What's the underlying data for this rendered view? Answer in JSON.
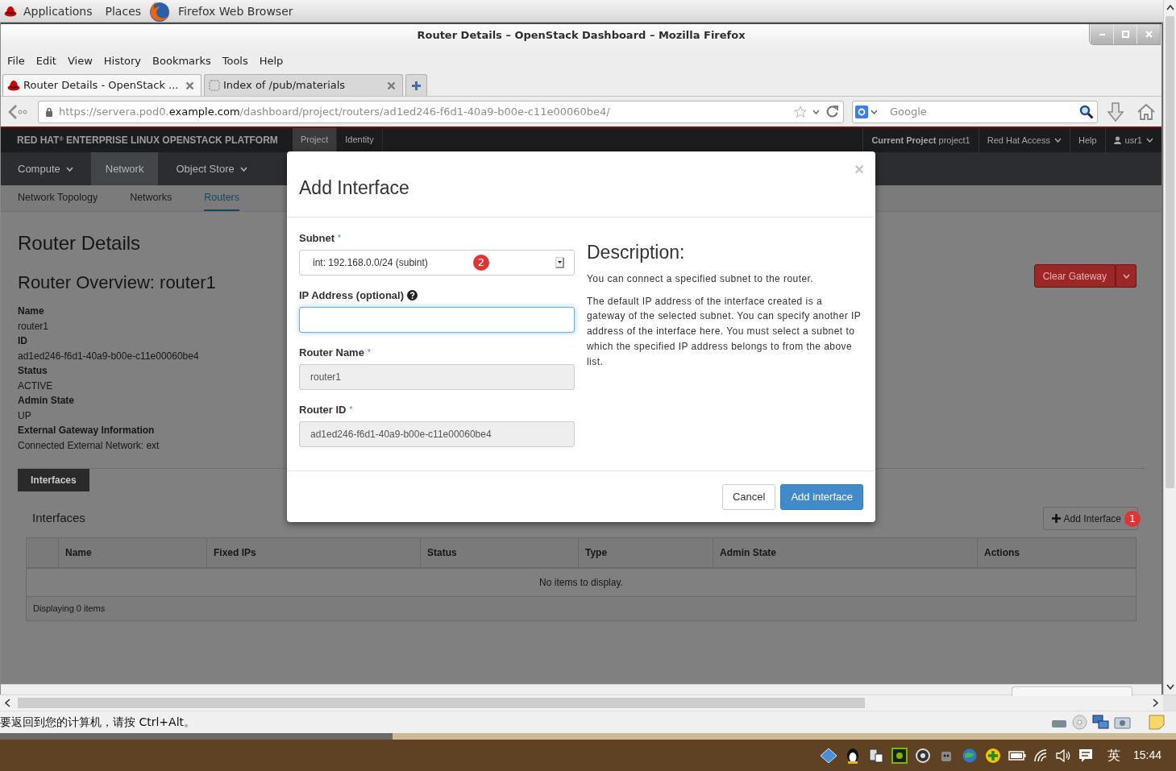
{
  "desktop": {
    "menus": [
      "Applications",
      "Places"
    ],
    "app_name": "Firefox Web Browser"
  },
  "browser": {
    "title": "Router Details – OpenStack Dashboard – Mozilla Firefox",
    "menu": [
      "File",
      "Edit",
      "View",
      "History",
      "Bookmarks",
      "Tools",
      "Help"
    ],
    "tabs": [
      {
        "label": "Router Details - OpenStack ...",
        "selected": true,
        "kind": "site"
      },
      {
        "label": "Index of /pub/materials",
        "selected": false,
        "kind": "blank"
      }
    ],
    "url": [
      {
        "text": "https://servera.pod0.",
        "highlight": false
      },
      {
        "text": "example.com",
        "highlight": true
      },
      {
        "text": "/dashboard/project/routers/ad1ed246-f6d1-40a9-b00e-c11e00060be4/",
        "highlight": false
      }
    ],
    "search": {
      "placeholder": "Google"
    }
  },
  "dashboard": {
    "brand": "RED HAT$^{®}$ ENTERPRISE LINUX OPENSTACK PLATFORM",
    "sections": [
      {
        "label": "Project",
        "selected": true
      },
      {
        "label": "Identity",
        "selected": false
      }
    ],
    "account": [
      {
        "label": "**Current Project** project1",
        "kind": "project"
      },
      {
        "label": "Red Hat Access",
        "kind": "menu"
      },
      {
        "label": "Help",
        "kind": "link"
      },
      {
        "label": "usr1",
        "kind": "user"
      }
    ],
    "panels": [
      {
        "label": "Compute",
        "selected": false,
        "dropdown": true
      },
      {
        "label": "Network",
        "selected": true,
        "dropdown": false
      },
      {
        "label": "Object Store",
        "selected": false,
        "dropdown": true
      }
    ],
    "subnav": [
      {
        "label": "Network Topology",
        "selected": false
      },
      {
        "label": "Networks",
        "selected": false
      },
      {
        "label": "Routers",
        "selected": true
      }
    ],
    "page_title": "Router Details",
    "overview_title": "Router Overview: router1",
    "details": [
      {
        "term": "Name",
        "value": "router1"
      },
      {
        "term": "ID",
        "value": "ad1ed246-f6d1-40a9-b00e-c11e00060be4"
      },
      {
        "term": "Status",
        "value": "ACTIVE"
      },
      {
        "term": "Admin State",
        "value": "UP"
      },
      {
        "term": "External Gateway Information",
        "value": "Connected External Network: ext"
      }
    ],
    "clear_gateway_button": "Clear Gateway",
    "detail_tabs": [
      {
        "label": "Interfaces",
        "selected": true
      }
    ],
    "interfaces": {
      "title": "Interfaces",
      "add_button": {
        "label": "Add Interface",
        "marker": "1"
      },
      "columns": [
        "Name",
        "Fixed IPs",
        "Status",
        "Type",
        "Admin State",
        "Actions"
      ],
      "empty_message": "No items to display.",
      "footer": "Displaying 0 items"
    }
  },
  "dialog": {
    "title": "Add Interface",
    "close": "×",
    "fields": [
      {
        "label": "Subnet",
        "kind": "select",
        "value": "int: 192.168.0.0/24 (subint)",
        "required_mark": "*",
        "marker": "2",
        "help": false,
        "focused": false
      },
      {
        "label": "IP Address (optional)",
        "kind": "text",
        "help": true,
        "focused": true
      },
      {
        "label": "Router Name",
        "kind": "readonly",
        "value": "router1",
        "required_mark": "*",
        "help": false,
        "focused": false
      },
      {
        "label": "Router ID",
        "kind": "readonly",
        "value": "ad1ed246-f6d1-40a9-b00e-c11e00060be4",
        "required_mark": "*",
        "help": false,
        "focused": false
      }
    ],
    "description": {
      "title": "Description:",
      "paragraphs": [
        "You can connect a specified subnet to the router.",
        "The default IP address of the interface created is a gateway of the selected subnet. You can specify another IP address of the interface here. You must select a subnet to which the specified IP address belongs to from the above list."
      ]
    },
    "buttons": [
      {
        "label": "Cancel",
        "kind": "default"
      },
      {
        "label": "Add interface",
        "kind": "primary"
      }
    ]
  },
  "viewer": {
    "message": "要返回到您的计算机，请按 Ctrl+Alt。"
  },
  "taskbar": {
    "input_method": "英",
    "time": "15:44"
  }
}
